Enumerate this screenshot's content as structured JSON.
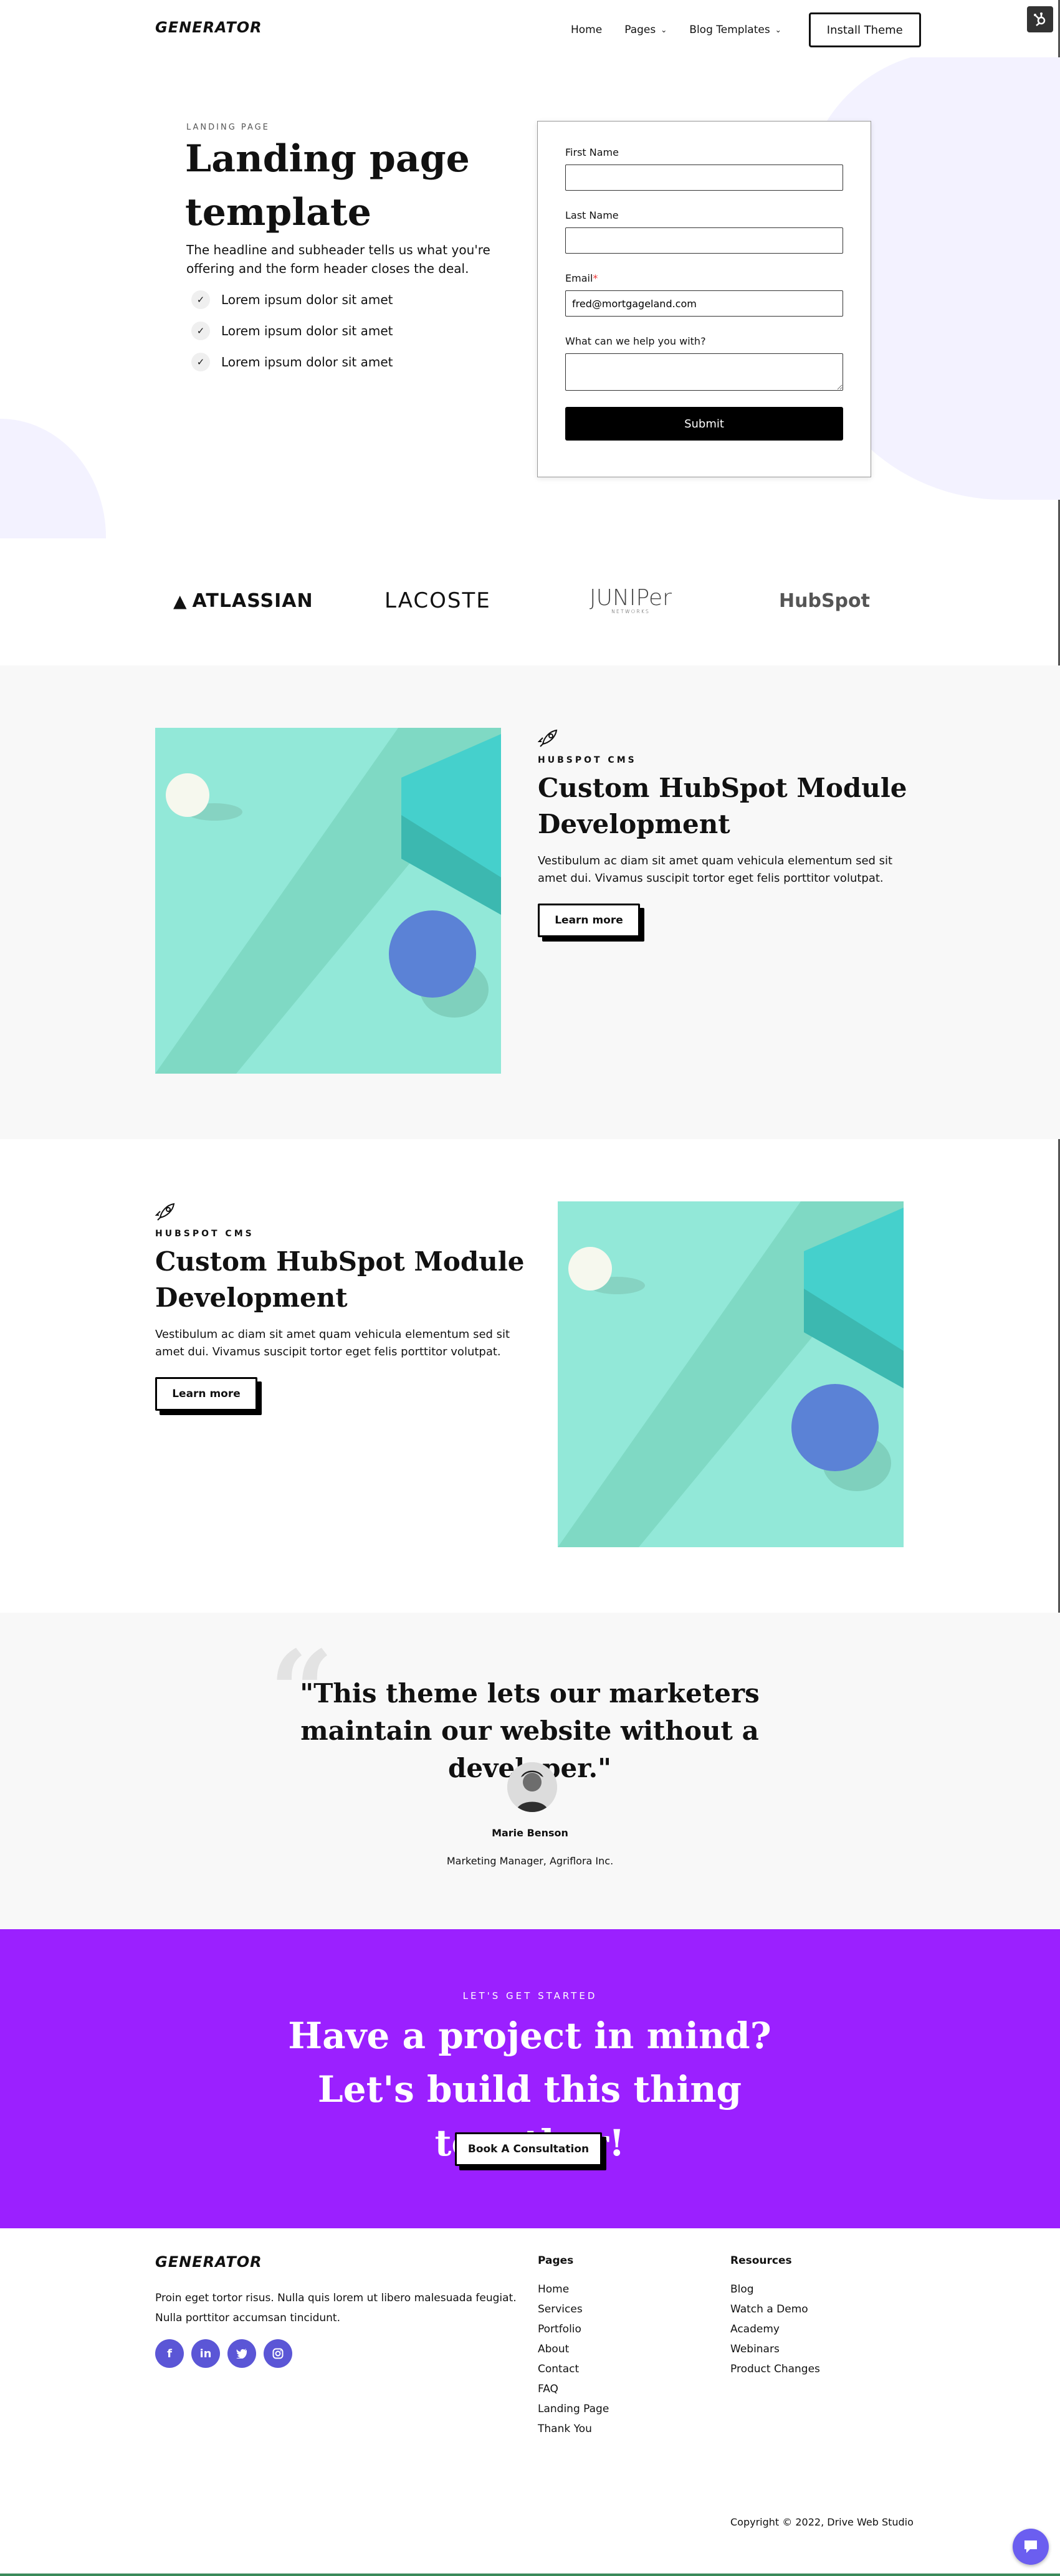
{
  "header": {
    "logo": "GENERATOR",
    "nav": [
      {
        "label": "Home"
      },
      {
        "label": "Pages"
      },
      {
        "label": "Blog Templates"
      }
    ],
    "install_label": "Install Theme"
  },
  "hero": {
    "eyebrow": "LANDING PAGE",
    "title": "Landing page template",
    "subtitle": "The headline and subheader tells us what you're offering and the form header closes the deal.",
    "bullets": [
      "Lorem ipsum dolor sit amet",
      "Lorem ipsum dolor sit amet",
      "Lorem ipsum dolor sit amet"
    ],
    "form": {
      "first_name_label": "First Name",
      "last_name_label": "Last Name",
      "email_label": "Email",
      "email_required_mark": "*",
      "email_value": "fred@mortgageland.com",
      "help_label": "What can we help you with?",
      "submit_label": "Submit"
    }
  },
  "logos": {
    "atlassian": "ATLASSIAN",
    "lacoste": "LACOSTE",
    "juniper": "JUNIPer",
    "juniper_sub": "NETWORKS",
    "hubspot": "HubSpot"
  },
  "features": [
    {
      "category": "HUBSPOT CMS",
      "title": "Custom HubSpot Module Development",
      "body": "Vestibulum ac diam sit amet quam vehicula elementum sed sit amet dui. Vivamus suscipit tortor eget felis porttitor volutpat.",
      "button": "Learn more",
      "icon": "rocket-icon"
    },
    {
      "category": "HUBSPOT CMS",
      "title": "Custom HubSpot Module Development",
      "body": "Vestibulum ac diam sit amet quam vehicula elementum sed sit amet dui. Vivamus suscipit tortor eget felis porttitor volutpat.",
      "button": "Learn more",
      "icon": "rocket-icon"
    }
  ],
  "testimonial": {
    "quote": "\"This theme lets our marketers maintain our website without a developer.\"",
    "name": "Marie Benson",
    "role": "Marketing Manager, Agriflora Inc."
  },
  "cta": {
    "eyebrow": "LET'S GET STARTED",
    "title": "Have a project in mind? Let's build this thing together!",
    "button": "Book A Consultation"
  },
  "footer": {
    "logo": "GENERATOR",
    "text": "Proin eget tortor risus. Nulla quis lorem ut libero malesuada feugiat. Nulla porttitor accumsan tincidunt.",
    "pages_heading": "Pages",
    "pages": [
      "Home",
      "Services",
      "Portfolio",
      "About",
      "Contact",
      "FAQ",
      "Landing Page",
      "Thank You"
    ],
    "resources_heading": "Resources",
    "resources": [
      "Blog",
      "Watch a Demo",
      "Academy",
      "Webinars",
      "Product Changes"
    ],
    "copyright": "Copyright © 2022, Drive Web Studio",
    "social_icons": [
      "facebook-icon",
      "linkedin-icon",
      "twitter-icon",
      "instagram-icon"
    ]
  },
  "colors": {
    "accent_purple": "#9b20ff",
    "social_blue": "#5b56d6",
    "teal": "#90e6d5",
    "chat": "#6b5ef0"
  }
}
